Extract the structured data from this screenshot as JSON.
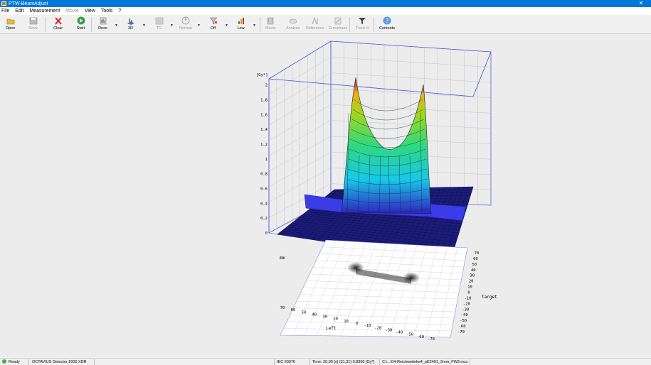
{
  "window": {
    "title": "PTW-BeamAdjust",
    "close_glyph": "✕"
  },
  "menu": {
    "items": [
      {
        "label": "File",
        "enabled": true
      },
      {
        "label": "Edit",
        "enabled": true
      },
      {
        "label": "Measurement",
        "enabled": true
      },
      {
        "label": "Movie",
        "enabled": false
      },
      {
        "label": "View",
        "enabled": true
      },
      {
        "label": "Tools",
        "enabled": true
      },
      {
        "label": "?",
        "enabled": true
      }
    ]
  },
  "toolbar": {
    "open": "Open",
    "save": "Save",
    "clear": "Clear",
    "start": "Start",
    "dose": "Dose",
    "view3d": "3D",
    "tg": "TG",
    "normal": "Normal",
    "off": "Off",
    "low": "Low",
    "movie": "Movie",
    "analyze": "Analyze",
    "reference": "Reference",
    "crosshairs": "Crosshairs",
    "track": "Track-it",
    "contents": "Contents"
  },
  "plot": {
    "zunit": "[Gy*]",
    "zticks": [
      "0",
      "0.2",
      "0.4",
      "0.6",
      "0.8",
      "1",
      "1.2",
      "1.4",
      "1.6",
      "1.8",
      "2"
    ],
    "mm_label": "mm",
    "left_label": "Left",
    "target_label": "Target",
    "left_ticks": [
      "70",
      "60",
      "50",
      "40",
      "30",
      "20",
      "10",
      "0",
      "-10",
      "-20",
      "-30",
      "-40",
      "-50",
      "-60",
      "-70"
    ],
    "target_ticks": [
      "70",
      "60",
      "50",
      "40",
      "30",
      "20",
      "10",
      "0",
      "-10",
      "-20",
      "-30",
      "-40",
      "-50",
      "-60",
      "-70"
    ],
    "colors": {
      "cube": "#5a5ae0",
      "grid": "#b8b8c8",
      "base": "#1c1c7a"
    }
  },
  "status": {
    "ready": "Ready",
    "detector": "OCTAVIUS Detector 1600 XDR",
    "iec": "IEC 60976",
    "time": "Time: 20,00 [s]  (31,31) 0,8306 [Gy*]",
    "file": "C:\\...\\04-Reichweiteke4_pE2491_2mm_FW3.mcc"
  }
}
